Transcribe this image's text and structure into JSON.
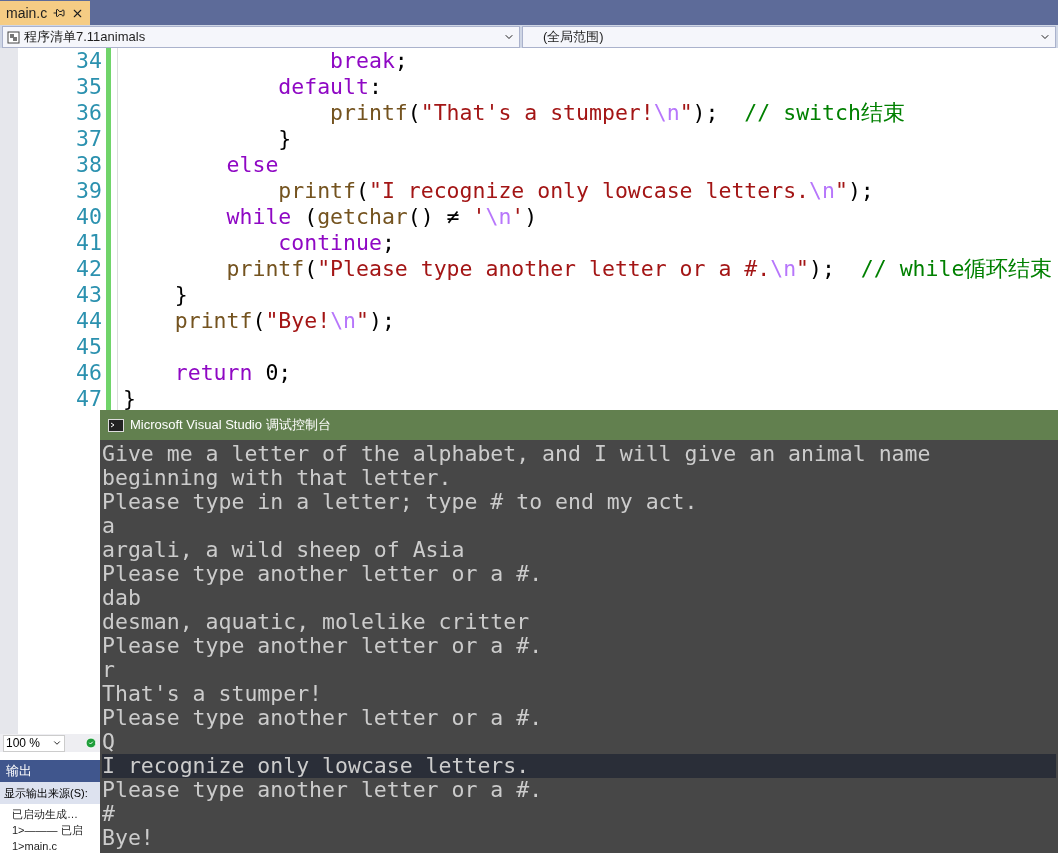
{
  "tab": {
    "label": "main.c",
    "selected": true
  },
  "navigation": {
    "project": "程序清单7.11animals",
    "scope": "(全局范围)"
  },
  "editor": {
    "lines": [
      {
        "number": "34",
        "tokens": [
          {
            "kind": "keyword",
            "text": "                break"
          },
          {
            "kind": "plain",
            "text": ";"
          }
        ]
      },
      {
        "number": "35",
        "tokens": [
          {
            "kind": "keyword",
            "text": "            default"
          },
          {
            "kind": "plain",
            "text": ":"
          }
        ]
      },
      {
        "number": "36",
        "tokens": [
          {
            "kind": "function",
            "text": "                printf"
          },
          {
            "kind": "plain",
            "text": "("
          },
          {
            "kind": "string",
            "text": "\"That's a stumper!"
          },
          {
            "kind": "escape",
            "text": "\\n"
          },
          {
            "kind": "string",
            "text": "\""
          },
          {
            "kind": "plain",
            "text": ");  "
          },
          {
            "kind": "comment",
            "text": "// switch结束"
          }
        ]
      },
      {
        "number": "37",
        "tokens": [
          {
            "kind": "plain",
            "text": "            }"
          }
        ]
      },
      {
        "number": "38",
        "tokens": [
          {
            "kind": "keyword",
            "text": "        else"
          }
        ]
      },
      {
        "number": "39",
        "tokens": [
          {
            "kind": "function",
            "text": "            printf"
          },
          {
            "kind": "plain",
            "text": "("
          },
          {
            "kind": "string",
            "text": "\"I recognize only lowcase letters."
          },
          {
            "kind": "escape",
            "text": "\\n"
          },
          {
            "kind": "string",
            "text": "\""
          },
          {
            "kind": "plain",
            "text": ");"
          }
        ]
      },
      {
        "number": "40",
        "tokens": [
          {
            "kind": "keyword",
            "text": "        while"
          },
          {
            "kind": "plain",
            "text": " ("
          },
          {
            "kind": "function",
            "text": "getchar"
          },
          {
            "kind": "plain",
            "text": "() ≠ "
          },
          {
            "kind": "string",
            "text": "'"
          },
          {
            "kind": "escape",
            "text": "\\n"
          },
          {
            "kind": "string",
            "text": "'"
          },
          {
            "kind": "plain",
            "text": ")"
          }
        ]
      },
      {
        "number": "41",
        "tokens": [
          {
            "kind": "keyword",
            "text": "            continue"
          },
          {
            "kind": "plain",
            "text": ";"
          }
        ]
      },
      {
        "number": "42",
        "tokens": [
          {
            "kind": "function",
            "text": "        printf"
          },
          {
            "kind": "plain",
            "text": "("
          },
          {
            "kind": "string",
            "text": "\"Please type another letter or a #."
          },
          {
            "kind": "escape",
            "text": "\\n"
          },
          {
            "kind": "string",
            "text": "\""
          },
          {
            "kind": "plain",
            "text": ");  "
          },
          {
            "kind": "comment",
            "text": "// while循环结束"
          }
        ]
      },
      {
        "number": "43",
        "tokens": [
          {
            "kind": "plain",
            "text": "    }"
          }
        ]
      },
      {
        "number": "44",
        "tokens": [
          {
            "kind": "function",
            "text": "    printf"
          },
          {
            "kind": "plain",
            "text": "("
          },
          {
            "kind": "string",
            "text": "\"Bye!"
          },
          {
            "kind": "escape",
            "text": "\\n"
          },
          {
            "kind": "string",
            "text": "\""
          },
          {
            "kind": "plain",
            "text": ");"
          }
        ]
      },
      {
        "number": "45"
      },
      {
        "number": "46",
        "tokens": [
          {
            "kind": "keyword",
            "text": "    return"
          },
          {
            "kind": "plain",
            "text": " 0;"
          }
        ]
      },
      {
        "number": "47",
        "tokens": [
          {
            "kind": "plain",
            "text": "}"
          }
        ]
      }
    ]
  },
  "status": {
    "zoom": "100 %"
  },
  "output": {
    "title": "输出",
    "source_label": "显示输出来源(S):",
    "lines": [
      "已启动生成…",
      "1>——— 已启",
      "1>main.c"
    ]
  },
  "console": {
    "title": "Microsoft Visual Studio 调试控制台",
    "lines": [
      {
        "kind": "normal",
        "text": "Give me a letter of the alphabet, and I will give an animal name"
      },
      {
        "kind": "normal",
        "text": "beginning with that letter."
      },
      {
        "kind": "normal",
        "text": "Please type in a letter; type # to end my act."
      },
      {
        "kind": "normal",
        "text": "a"
      },
      {
        "kind": "normal",
        "text": "argali, a wild sheep of Asia"
      },
      {
        "kind": "normal",
        "text": "Please type another letter or a #."
      },
      {
        "kind": "normal",
        "text": "dab"
      },
      {
        "kind": "normal",
        "text": "desman, aquatic, molelike critter"
      },
      {
        "kind": "normal",
        "text": "Please type another letter or a #."
      },
      {
        "kind": "normal",
        "text": "r"
      },
      {
        "kind": "normal",
        "text": "That's a stumper!"
      },
      {
        "kind": "normal",
        "text": "Please type another letter or a #."
      },
      {
        "kind": "normal",
        "text": "Q"
      },
      {
        "kind": "shaded",
        "text": "I recognize only lowcase letters."
      },
      {
        "kind": "normal",
        "text": "Please type another letter or a #."
      },
      {
        "kind": "normal",
        "text": "#"
      },
      {
        "kind": "normal",
        "text": "Bye!"
      }
    ]
  }
}
